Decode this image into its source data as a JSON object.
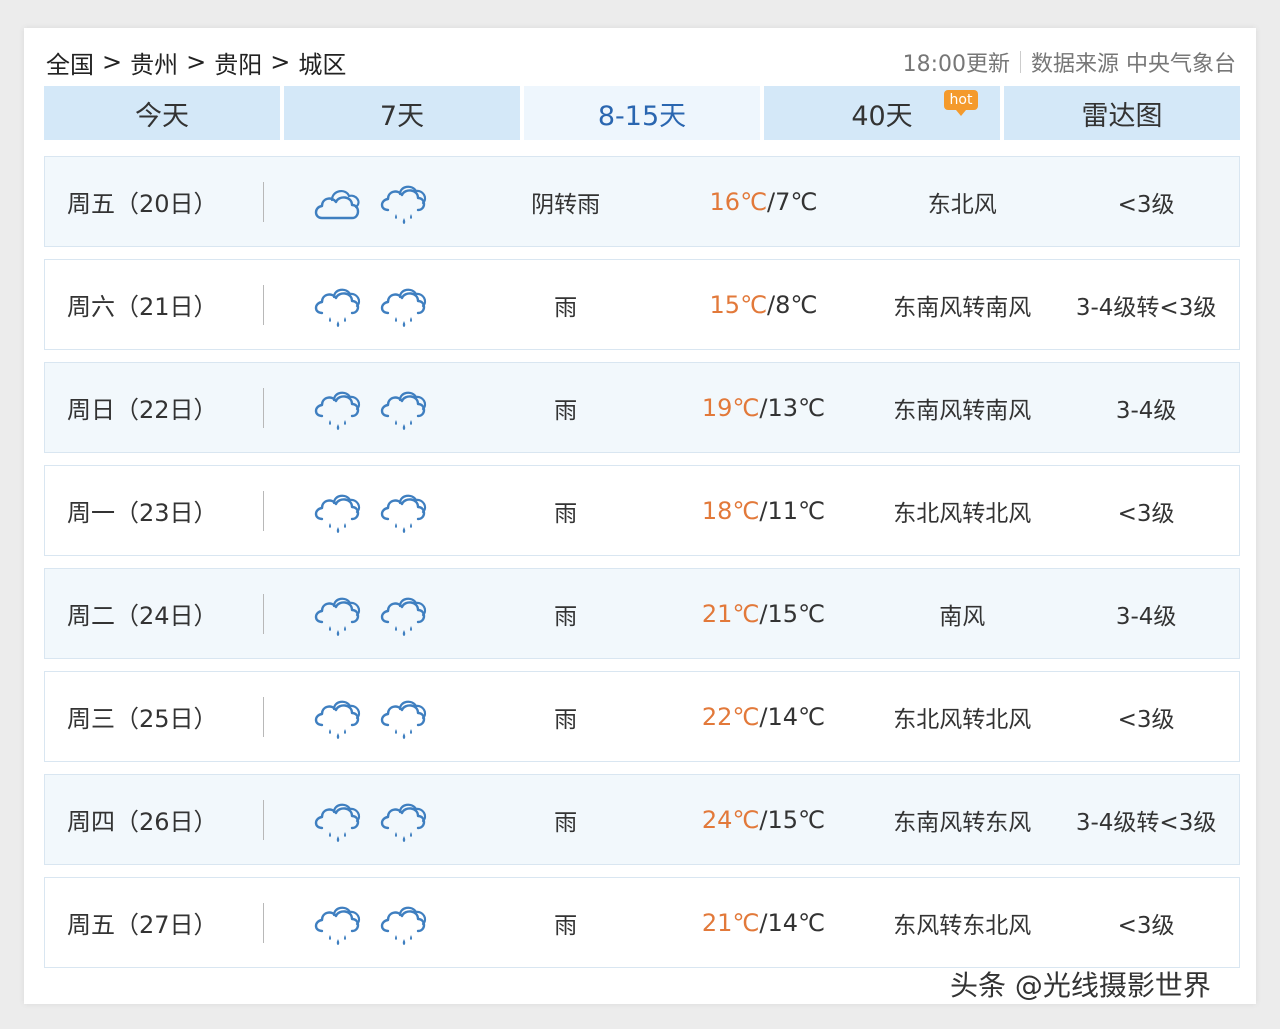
{
  "breadcrumb": [
    "全国",
    "贵州",
    "贵阳",
    "城区"
  ],
  "breadcrumb_sep": ">",
  "update_time": "18:00更新",
  "source_label": "数据来源 中央气象台",
  "tabs": [
    {
      "label": "今天"
    },
    {
      "label": "7天"
    },
    {
      "label": "8-15天",
      "active": true
    },
    {
      "label": "40天",
      "badge": "hot"
    },
    {
      "label": "雷达图"
    }
  ],
  "days": [
    {
      "day": "周五（20日）",
      "icons": [
        "cloudy-icon",
        "rain-icon"
      ],
      "weather": "阴转雨",
      "high": "16℃",
      "low": "/7℃",
      "wind": "东北风",
      "level": "<3级"
    },
    {
      "day": "周六（21日）",
      "icons": [
        "rain-icon",
        "rain-icon"
      ],
      "weather": "雨",
      "high": "15℃",
      "low": "/8℃",
      "wind": "东南风转南风",
      "level": "3-4级转<3级"
    },
    {
      "day": "周日（22日）",
      "icons": [
        "rain-icon",
        "rain-icon"
      ],
      "weather": "雨",
      "high": "19℃",
      "low": "/13℃",
      "wind": "东南风转南风",
      "level": "3-4级"
    },
    {
      "day": "周一（23日）",
      "icons": [
        "rain-icon",
        "rain-icon"
      ],
      "weather": "雨",
      "high": "18℃",
      "low": "/11℃",
      "wind": "东北风转北风",
      "level": "<3级"
    },
    {
      "day": "周二（24日）",
      "icons": [
        "rain-icon",
        "rain-icon"
      ],
      "weather": "雨",
      "high": "21℃",
      "low": "/15℃",
      "wind": "南风",
      "level": "3-4级"
    },
    {
      "day": "周三（25日）",
      "icons": [
        "rain-icon",
        "rain-icon"
      ],
      "weather": "雨",
      "high": "22℃",
      "low": "/14℃",
      "wind": "东北风转北风",
      "level": "<3级"
    },
    {
      "day": "周四（26日）",
      "icons": [
        "rain-icon",
        "rain-icon"
      ],
      "weather": "雨",
      "high": "24℃",
      "low": "/15℃",
      "wind": "东南风转东风",
      "level": "3-4级转<3级"
    },
    {
      "day": "周五（27日）",
      "icons": [
        "rain-icon",
        "rain-icon"
      ],
      "weather": "雨",
      "high": "21℃",
      "low": "/14℃",
      "wind": "东风转东北风",
      "level": "<3级"
    }
  ],
  "watermark": "头条 @光线摄影世界",
  "colors": {
    "tab_bg": "#d4e8f8",
    "tab_active_bg": "#eef6fd",
    "tab_active_text": "#2a66b0",
    "high_temp": "#e2793a",
    "hot_badge": "#f49a2c",
    "row_alt_bg": "#f2f8fc",
    "icon_stroke": "#3f7fc0"
  }
}
